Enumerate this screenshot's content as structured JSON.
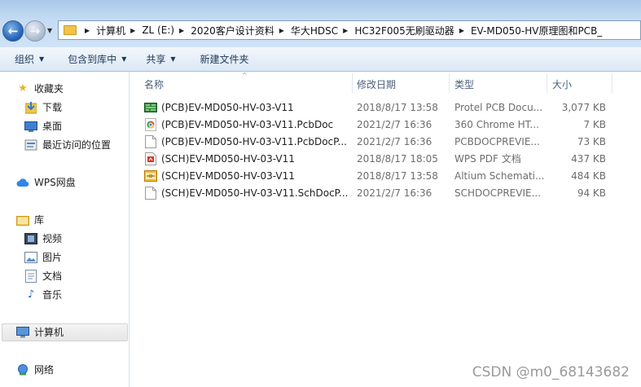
{
  "address_bar": {
    "crumbs": [
      "计算机",
      "ZL (E:)",
      "2020客户设计资料",
      "华大HDSC",
      "HC32F005无刷驱动器",
      "EV-MD050-HV原理图和PCB_"
    ]
  },
  "toolbar": {
    "organize": "组织",
    "include_in_library": "包含到库中",
    "share": "共享",
    "new_folder": "新建文件夹"
  },
  "nav_pane": {
    "favorites": "收藏夹",
    "downloads": "下载",
    "desktop": "桌面",
    "recent": "最近访问的位置",
    "wps_drive": "WPS网盘",
    "libraries": "库",
    "videos": "视频",
    "pictures": "图片",
    "documents": "文档",
    "music": "音乐",
    "computer": "计算机",
    "network": "网络"
  },
  "columns": {
    "name": "名称",
    "date": "修改日期",
    "type": "类型",
    "size": "大小"
  },
  "files": [
    {
      "name": "(PCB)EV-MD050-HV-03-V11",
      "date": "2018/8/17 13:58",
      "type": "Protel PCB Docu...",
      "size": "3,077 KB",
      "icon": "pcb-icon"
    },
    {
      "name": "(PCB)EV-MD050-HV-03-V11.PcbDoc",
      "date": "2021/2/7 16:36",
      "type": "360 Chrome HT...",
      "size": "7 KB",
      "icon": "chrome-html-icon"
    },
    {
      "name": "(PCB)EV-MD050-HV-03-V11.PcbDocP...",
      "date": "2021/2/7 16:36",
      "type": "PCBDOCPREVIE...",
      "size": "73 KB",
      "icon": "blank-file-icon"
    },
    {
      "name": "(SCH)EV-MD050-HV-03-V11",
      "date": "2018/8/17 18:05",
      "type": "WPS PDF 文档",
      "size": "437 KB",
      "icon": "pdf-icon"
    },
    {
      "name": "(SCH)EV-MD050-HV-03-V11",
      "date": "2018/8/17 13:58",
      "type": "Altium Schemati...",
      "size": "484 KB",
      "icon": "schematic-icon"
    },
    {
      "name": "(SCH)EV-MD050-HV-03-V11.SchDocP...",
      "date": "2021/2/7 16:36",
      "type": "SCHDOCPREVIE...",
      "size": "94 KB",
      "icon": "blank-file-icon"
    }
  ],
  "watermark": "CSDN @m0_68143682"
}
